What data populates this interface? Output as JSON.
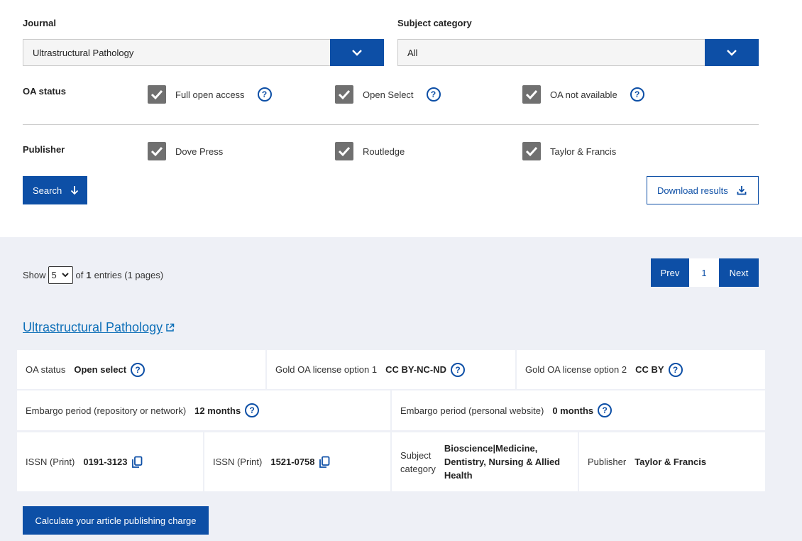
{
  "filters": {
    "journal_label": "Journal",
    "journal_value": "Ultrastructural Pathology",
    "subject_label": "Subject category",
    "subject_value": "All",
    "oa_label": "OA status",
    "oa_options": [
      "Full open access",
      "Open Select",
      "OA not available"
    ],
    "publisher_label": "Publisher",
    "publisher_options": [
      "Dove Press",
      "Routledge",
      "Taylor & Francis"
    ],
    "search_label": "Search",
    "download_label": "Download results"
  },
  "results": {
    "show_label": "Show",
    "page_size": "5",
    "of_label": "of",
    "entries_count": "1",
    "entries_suffix": "entries (1 pages)",
    "prev_label": "Prev",
    "current_page": "1",
    "next_label": "Next"
  },
  "journal": {
    "title": "Ultrastructural Pathology",
    "oa_status_key": "OA status",
    "oa_status_val": "Open select",
    "gold1_key": "Gold OA license option 1",
    "gold1_val": "CC BY-NC-ND",
    "gold2_key": "Gold OA license option 2",
    "gold2_val": "CC BY",
    "embargo_repo_key": "Embargo period (repository or network)",
    "embargo_repo_val": "12 months",
    "embargo_personal_key": "Embargo period (personal website)",
    "embargo_personal_val": "0 months",
    "issn1_key": "ISSN (Print)",
    "issn1_val": "0191-3123",
    "issn2_key": "ISSN (Print)",
    "issn2_val": "1521-0758",
    "subject_key_1": "Subject",
    "subject_key_2": "category",
    "subject_val_1": "Bioscience|Medicine,",
    "subject_val_2": "Dentistry, Nursing & Allied",
    "subject_val_3": "Health",
    "publisher_key": "Publisher",
    "publisher_val": "Taylor & Francis",
    "apc_button": "Calculate your article publishing charge"
  },
  "colors": {
    "primary": "#0d4fa6",
    "checkbox": "#707070",
    "panel": "#eef0f6"
  },
  "icons": [
    "chevron-down-icon",
    "check-icon",
    "help-icon",
    "arrow-down-icon",
    "download-icon",
    "external-link-icon",
    "copy-icon"
  ]
}
